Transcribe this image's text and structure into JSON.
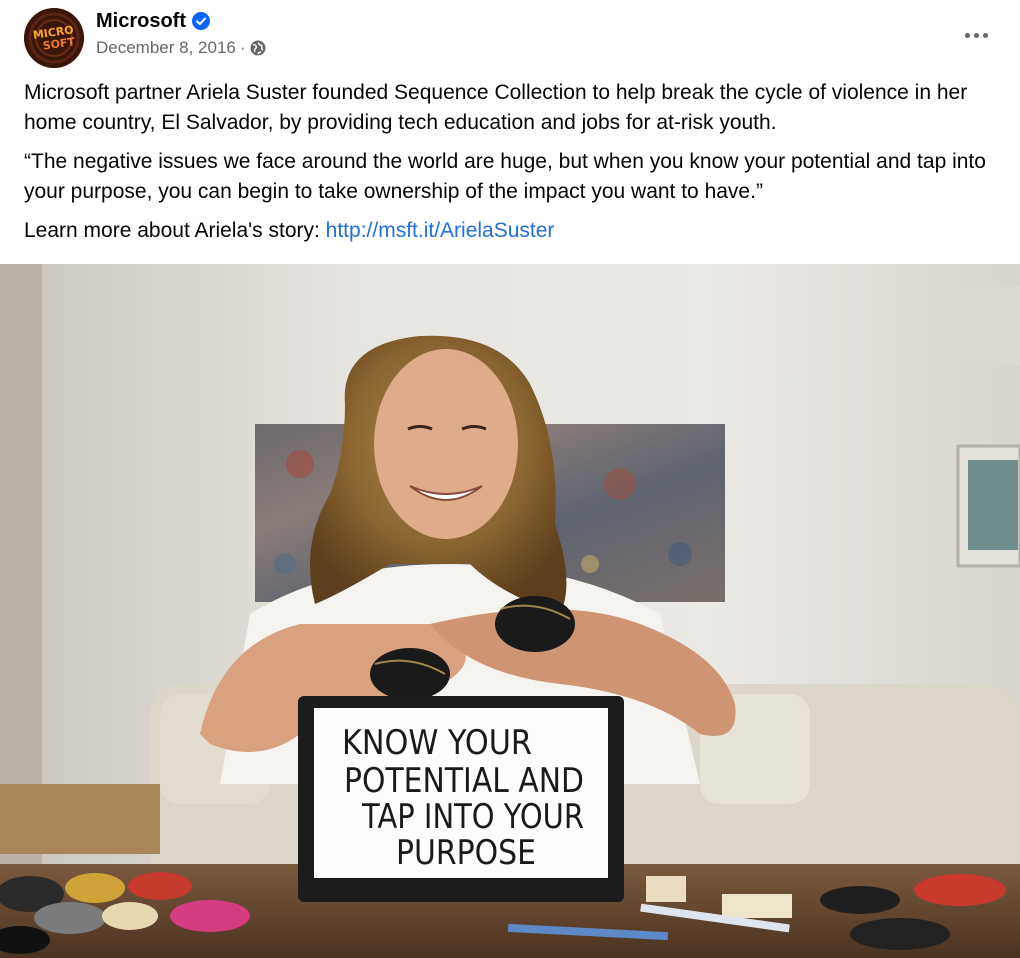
{
  "post": {
    "page_name": "Microsoft",
    "avatar_text": "MICROSOFT",
    "verified_icon": "verified-badge-icon",
    "date": "December 8, 2016",
    "separator": "·",
    "audience_icon": "globe-icon",
    "more_icon": "more-options-icon",
    "paragraphs": [
      "Microsoft partner Ariela Suster founded Sequence Collection to help break the cycle of violence in her home country, El Salvador, by providing tech education and jobs for at-risk youth.",
      "“The negative issues we face around the world are huge, but when you know your potential and tap into your purpose, you can begin to take ownership of the impact you want to have.”"
    ],
    "learn_more_prefix": "Learn more about Ariela's story: ",
    "link_text": "http://msft.it/ArielaSuster",
    "photo": {
      "sign_lines": [
        "KNOW YOUR",
        "POTENTIAL AND",
        "TAP INTO YOUR",
        "PURPOSE"
      ]
    }
  },
  "colors": {
    "link": "#216fdb",
    "secondary_text": "#65676b",
    "verified": "#0866ff"
  }
}
